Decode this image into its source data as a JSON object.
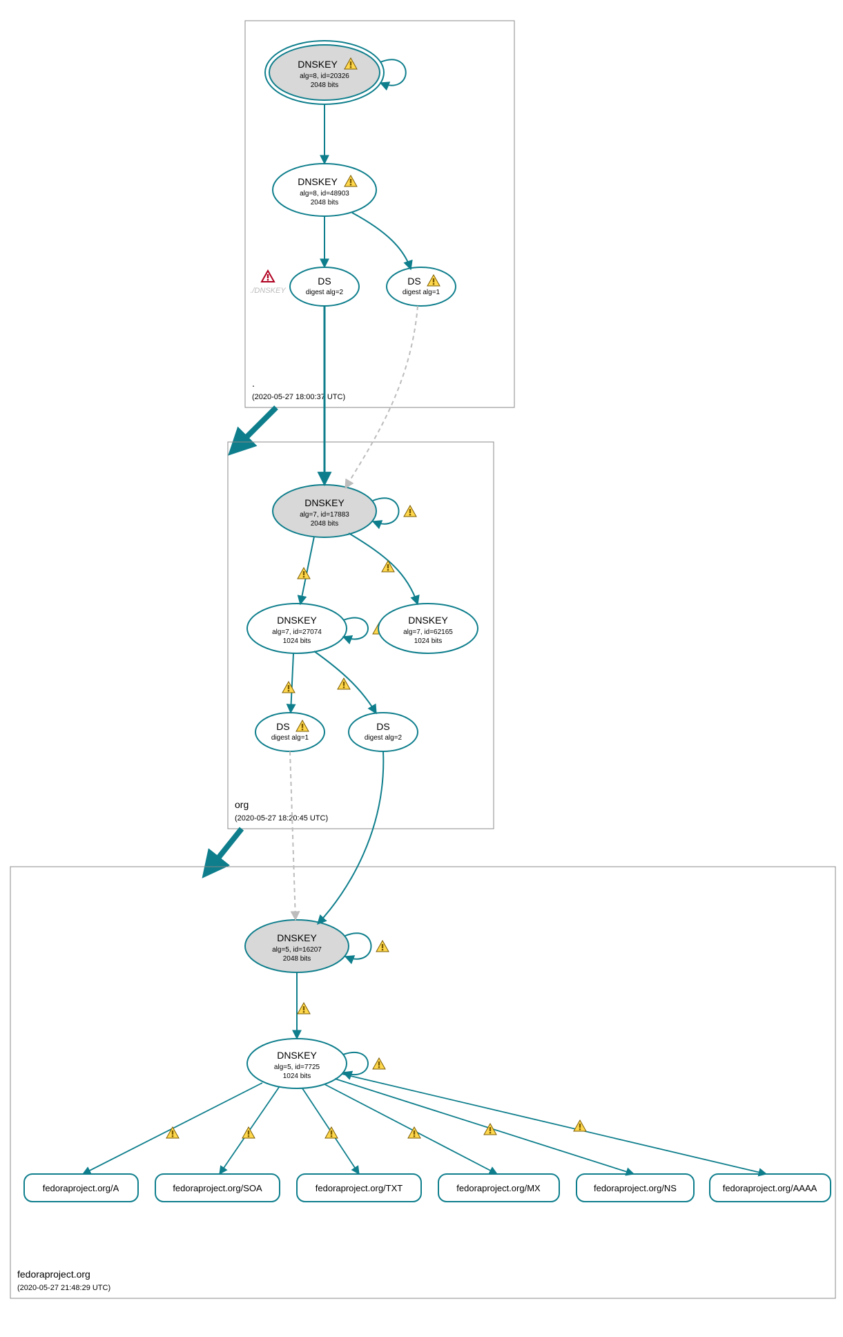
{
  "colors": {
    "stroke": "#0e7e8c",
    "fill_grey": "#d8d8d8",
    "fill_white": "#ffffff",
    "zone_border": "#888888",
    "dashed": "#bcbcbc",
    "error": "#b00020",
    "warn": "#f2c200",
    "warn_edge": "#333",
    "text_faded": "#cccccc"
  },
  "zones": {
    "root": {
      "label": ".",
      "timestamp": "(2020-05-27 18:00:37 UTC)"
    },
    "org": {
      "label": "org",
      "timestamp": "(2020-05-27 18:20:45 UTC)"
    },
    "fp": {
      "label": "fedoraproject.org",
      "timestamp": "(2020-05-27 21:48:29 UTC)"
    }
  },
  "nodes": {
    "root_ksk": {
      "title": "DNSKEY",
      "line1": "alg=8, id=20326",
      "line2": "2048 bits"
    },
    "root_zsk": {
      "title": "DNSKEY",
      "line1": "alg=8, id=48903",
      "line2": "2048 bits"
    },
    "root_ds2": {
      "title": "DS",
      "line1": "digest alg=2"
    },
    "root_ds1": {
      "title": "DS",
      "line1": "digest alg=1"
    },
    "root_neg": {
      "title": "./DNSKEY"
    },
    "org_ksk": {
      "title": "DNSKEY",
      "line1": "alg=7, id=17883",
      "line2": "2048 bits"
    },
    "org_zsk1": {
      "title": "DNSKEY",
      "line1": "alg=7, id=27074",
      "line2": "1024 bits"
    },
    "org_zsk2": {
      "title": "DNSKEY",
      "line1": "alg=7, id=62165",
      "line2": "1024 bits"
    },
    "org_ds1": {
      "title": "DS",
      "line1": "digest alg=1"
    },
    "org_ds2": {
      "title": "DS",
      "line1": "digest alg=2"
    },
    "fp_ksk": {
      "title": "DNSKEY",
      "line1": "alg=5, id=16207",
      "line2": "2048 bits"
    },
    "fp_zsk": {
      "title": "DNSKEY",
      "line1": "alg=5, id=7725",
      "line2": "1024 bits"
    },
    "rr_a": {
      "label": "fedoraproject.org/A"
    },
    "rr_soa": {
      "label": "fedoraproject.org/SOA"
    },
    "rr_txt": {
      "label": "fedoraproject.org/TXT"
    },
    "rr_mx": {
      "label": "fedoraproject.org/MX"
    },
    "rr_ns": {
      "label": "fedoraproject.org/NS"
    },
    "rr_aaaa": {
      "label": "fedoraproject.org/AAAA"
    }
  }
}
